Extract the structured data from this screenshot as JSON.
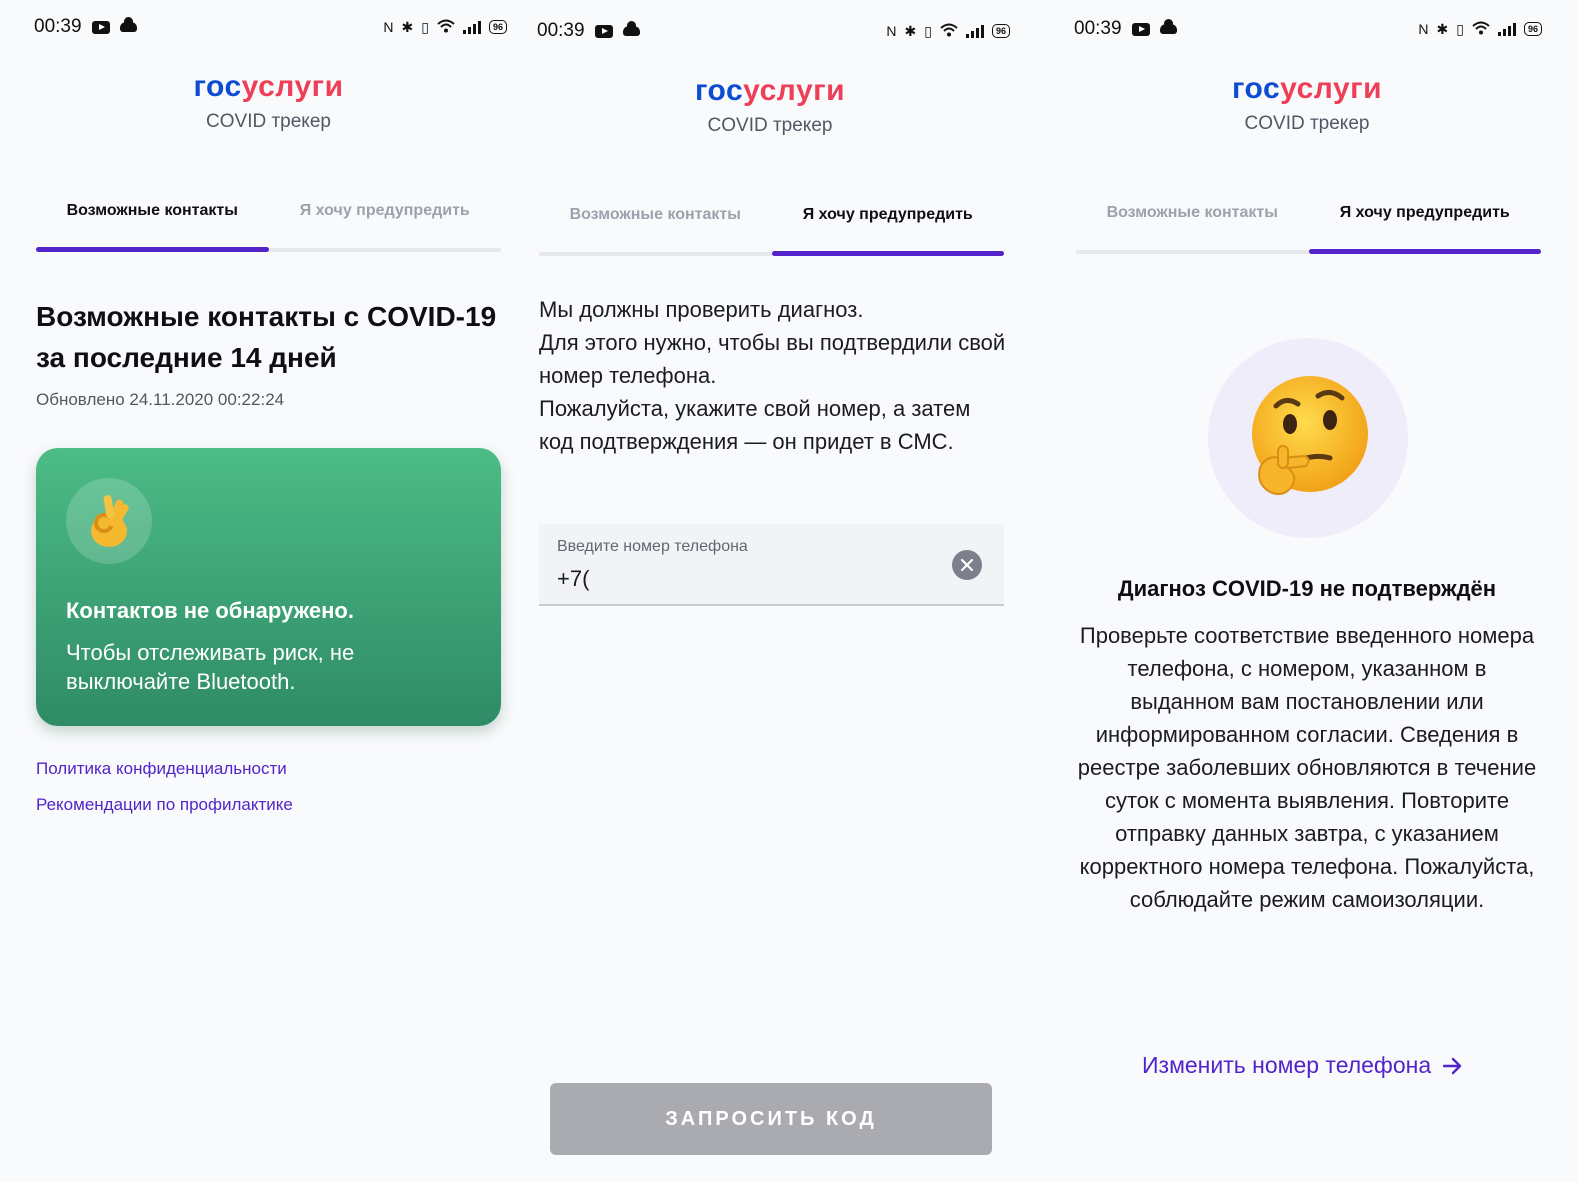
{
  "status_bar": {
    "time": "00:39",
    "battery": "96"
  },
  "header": {
    "logo_part1": "гос",
    "logo_part2": "услуги",
    "subtitle": "COVID трекер"
  },
  "tabs": {
    "contacts": "Возможные контакты",
    "warn": "Я хочу предупредить"
  },
  "screen1": {
    "title": "Возможные контакты с COVID-19 за последние 14 дней",
    "updated": "Обновлено 24.11.2020 00:22:24",
    "card_title": "Контактов не обнаружено.",
    "card_text": "Чтобы отслеживать риск, не выключайте Bluetooth.",
    "link_privacy": "Политика конфиденциальности",
    "link_prevention": "Рекомендации по профилактике"
  },
  "screen2": {
    "text_line1": "Мы должны проверить диагноз.",
    "text_line2": "Для этого нужно, чтобы вы подтвердили свой номер телефона.",
    "text_line3": "Пожалуйста, укажите свой номер, а затем код подтверждения — он придет в СМС.",
    "phone_label": "Введите номер телефона",
    "phone_value": "+7(",
    "request_button": "ЗАПРОСИТЬ КОД"
  },
  "screen3": {
    "title": "Диагноз COVID-19 не подтверждён",
    "text": "Проверьте соответствие введенного номера телефона, с номером, указанном в выданном вам постановлении или информированном согласии. Сведения в реестре заболевших обновляются в течение суток с момента выявления. Повторите отправку данных завтра, с указанием корректного номера телефона. Пожалуйста, соблюдайте режим самоизоляции.",
    "change_link": "Изменить номер телефона"
  },
  "colors": {
    "accent": "#5224c9",
    "logo_blue": "#0d4cd3",
    "logo_red": "#ee3f58",
    "card_green": "#3ea677",
    "button_disabled": "#a9abb1"
  },
  "icons": [
    "youtube-icon",
    "cloud-icon",
    "nfc-icon",
    "bluetooth-icon",
    "vibrate-icon",
    "wifi-icon",
    "signal-icon",
    "battery-icon",
    "ok-hand-icon",
    "clear-icon",
    "thinking-face-icon",
    "arrow-right-icon"
  ]
}
